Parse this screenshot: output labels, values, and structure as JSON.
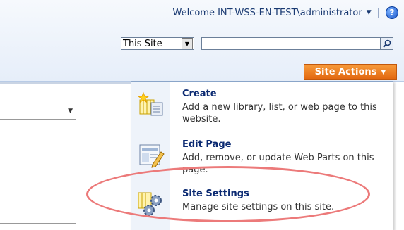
{
  "header": {
    "welcome_text": "Welcome INT-WSS-EN-TEST\\administrator",
    "divider": "|",
    "help_glyph": "?"
  },
  "search": {
    "scope_value": "This Site",
    "query_value": "",
    "query_placeholder": ""
  },
  "site_actions": {
    "label": "Site Actions",
    "accent_color": "#e8761e"
  },
  "menu": {
    "items": [
      {
        "title": "Create",
        "description": "Add a new library, list, or web page to this website.",
        "icon": "create-icon"
      },
      {
        "title": "Edit Page",
        "description": "Add, remove, or update Web Parts on this page.",
        "icon": "edit-page-icon"
      },
      {
        "title": "Site Settings",
        "description": "Manage site settings on this site.",
        "icon": "site-settings-icon"
      }
    ]
  },
  "annotation": {
    "highlight_color": "#ec7a7a",
    "highlighted_item": "Site Settings"
  }
}
